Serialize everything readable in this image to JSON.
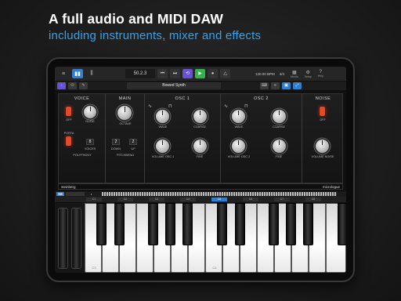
{
  "headline": "A full audio and MIDI DAW",
  "subline": "including instruments, mixer and effects",
  "toolbar": {
    "position": "50.2.3",
    "tempo": "120.00 BPM",
    "signature": "4/4",
    "preset": "Bowed Synth",
    "right_icons": [
      "Media",
      "Setup",
      "Help"
    ]
  },
  "sections": {
    "voice": "VOICE",
    "main": "MAIN",
    "osc1": "OSC 1",
    "osc2": "OSC 2",
    "noise": "NOISE"
  },
  "labels": {
    "off": "OFF",
    "glide": "GLIDE",
    "octave": "OCTAVE",
    "wave": "WAVE",
    "coarse": "COARSE",
    "porta": "PORTA",
    "voices": "VOICES",
    "polyphony": "POLYPHONY",
    "down": "DOWN",
    "up": "UP",
    "pitchbend": "PITCHBEND",
    "volume_osc1": "VOLUME OSC 1",
    "volume_osc2": "VOLUME OSC 2",
    "fine": "FINE",
    "volume_noise": "VOLUME NOISE"
  },
  "values": {
    "voices": "8",
    "down": "2",
    "up": "2"
  },
  "brand": "steinberg",
  "model": "micrologue",
  "keyboard": {
    "octaves": [
      "C1",
      "C2",
      "C3",
      "C4",
      "C5",
      "C6",
      "C7",
      "C8"
    ],
    "c_labels": [
      "C3",
      "C4"
    ]
  },
  "colors": {
    "accent": "#2f7fd0",
    "play": "#2fb54b",
    "loop": "#6a50d8",
    "switch": "#e24a2a",
    "headline": "#ffffff",
    "subline": "#3aa0e6"
  }
}
